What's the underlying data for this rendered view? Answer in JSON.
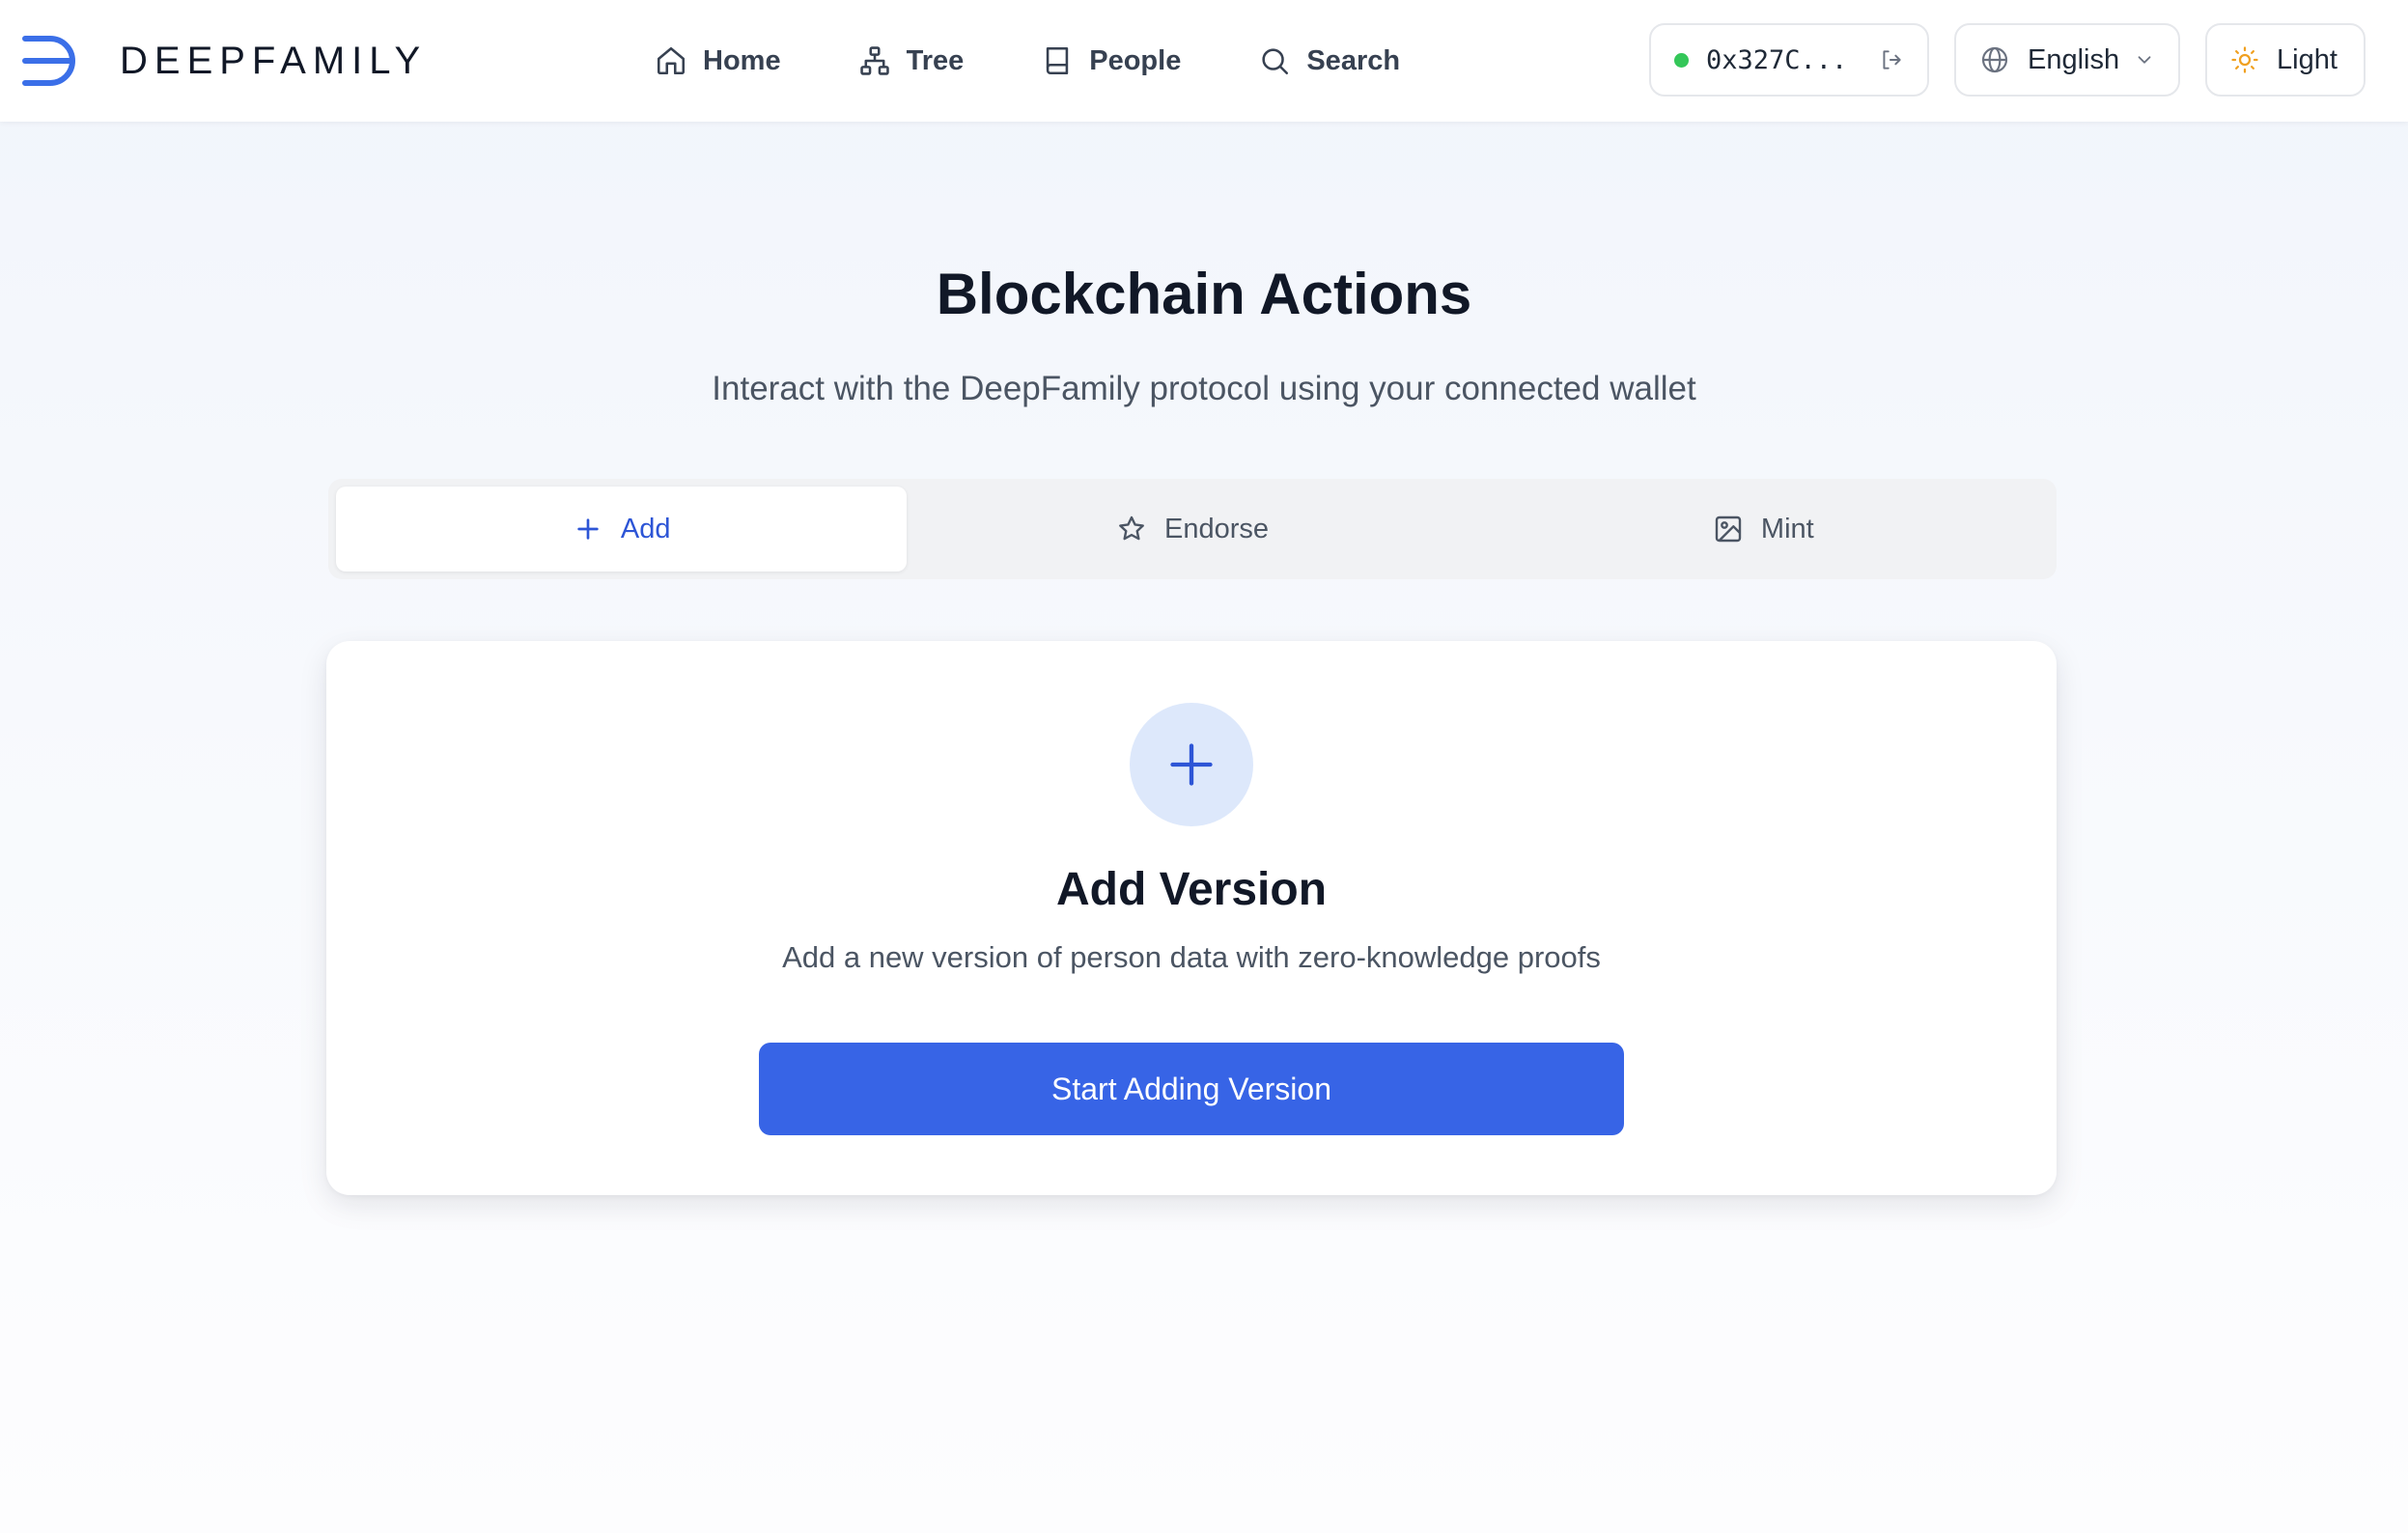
{
  "header": {
    "brand_name": "DEEPFAMILY",
    "nav": [
      {
        "label": "Home",
        "icon": "home-icon"
      },
      {
        "label": "Tree",
        "icon": "tree-icon"
      },
      {
        "label": "People",
        "icon": "book-icon"
      },
      {
        "label": "Search",
        "icon": "search-icon"
      }
    ],
    "wallet": {
      "address": "0x327C...",
      "status_color": "#34c759"
    },
    "language": {
      "selected": "English"
    },
    "theme": {
      "label": "Light"
    }
  },
  "main": {
    "title": "Blockchain Actions",
    "subtitle": "Interact with the DeepFamily protocol using your connected wallet",
    "tabs": [
      {
        "label": "Add",
        "icon": "plus-icon",
        "active": true
      },
      {
        "label": "Endorse",
        "icon": "star-icon",
        "active": false
      },
      {
        "label": "Mint",
        "icon": "image-icon",
        "active": false
      }
    ],
    "card": {
      "title": "Add Version",
      "description": "Add a new version of person data with zero-knowledge proofs",
      "button_label": "Start Adding Version"
    }
  },
  "colors": {
    "accent": "#3764e6",
    "accent_text": "#2d55d6",
    "icon_bg": "#dde8fb",
    "sun": "#f0a020"
  }
}
